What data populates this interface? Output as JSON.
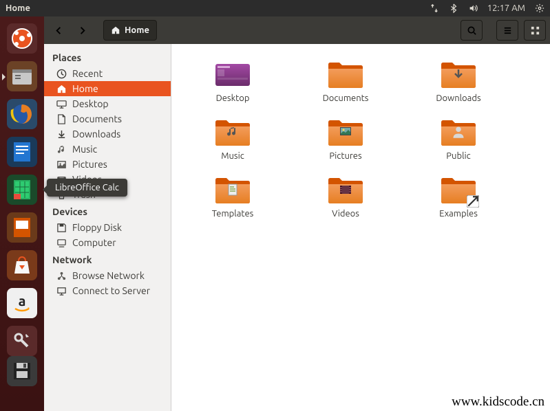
{
  "menubar": {
    "title": "Home",
    "time": "12:17 AM"
  },
  "toolbar": {
    "location": "Home"
  },
  "tooltip": "LibreOffice Calc",
  "sidebar": {
    "places_hdr": "Places",
    "places": [
      {
        "label": "Recent",
        "icon": "clock"
      },
      {
        "label": "Home",
        "icon": "home",
        "sel": true
      },
      {
        "label": "Desktop",
        "icon": "desktop"
      },
      {
        "label": "Documents",
        "icon": "doc"
      },
      {
        "label": "Downloads",
        "icon": "down"
      },
      {
        "label": "Music",
        "icon": "music"
      },
      {
        "label": "Pictures",
        "icon": "pic"
      },
      {
        "label": "Videos",
        "icon": "video"
      },
      {
        "label": "Trash",
        "icon": "trash"
      }
    ],
    "devices_hdr": "Devices",
    "devices": [
      {
        "label": "Floppy Disk",
        "icon": "floppy"
      },
      {
        "label": "Computer",
        "icon": "computer"
      }
    ],
    "network_hdr": "Network",
    "network": [
      {
        "label": "Browse Network",
        "icon": "net"
      },
      {
        "label": "Connect to Server",
        "icon": "server"
      }
    ]
  },
  "folders": [
    {
      "label": "Desktop",
      "emblem": "desktop"
    },
    {
      "label": "Documents",
      "emblem": ""
    },
    {
      "label": "Downloads",
      "emblem": "down"
    },
    {
      "label": "Music",
      "emblem": "music"
    },
    {
      "label": "Pictures",
      "emblem": "pic"
    },
    {
      "label": "Public",
      "emblem": "person"
    },
    {
      "label": "Templates",
      "emblem": "doc"
    },
    {
      "label": "Videos",
      "emblem": "video"
    },
    {
      "label": "Examples",
      "emblem": "link"
    }
  ],
  "watermark": "www.kidscode.cn"
}
